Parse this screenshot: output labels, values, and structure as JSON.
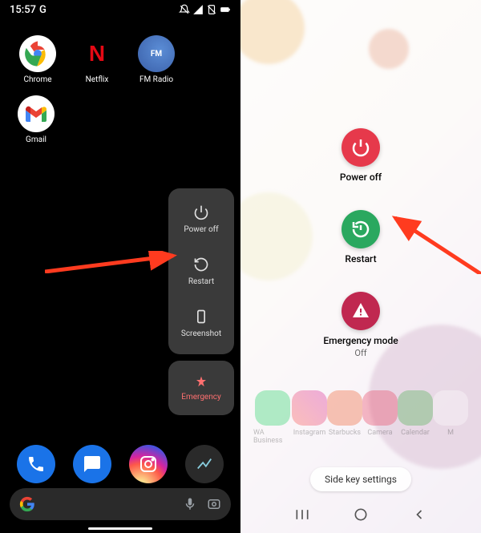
{
  "left": {
    "status": {
      "time": "15:57",
      "indicator": "G"
    },
    "apps": [
      {
        "label": "Chrome"
      },
      {
        "label": "Netflix"
      },
      {
        "label": "FM Radio",
        "tag": "FM"
      },
      {
        "label": "Gmail"
      }
    ],
    "power_menu": {
      "poweroff": "Power off",
      "restart": "Restart",
      "screenshot": "Screenshot",
      "emergency": "Emergency"
    }
  },
  "right": {
    "power_menu": {
      "poweroff": "Power off",
      "restart": "Restart",
      "emergency": "Emergency mode",
      "emergency_sub": "Off"
    },
    "ghost_apps": [
      {
        "label": "WA Business"
      },
      {
        "label": "Instagram"
      },
      {
        "label": "Starbucks"
      },
      {
        "label": "Camera"
      },
      {
        "label": "Calendar"
      },
      {
        "label": "M"
      }
    ],
    "sidekey": "Side key settings"
  }
}
